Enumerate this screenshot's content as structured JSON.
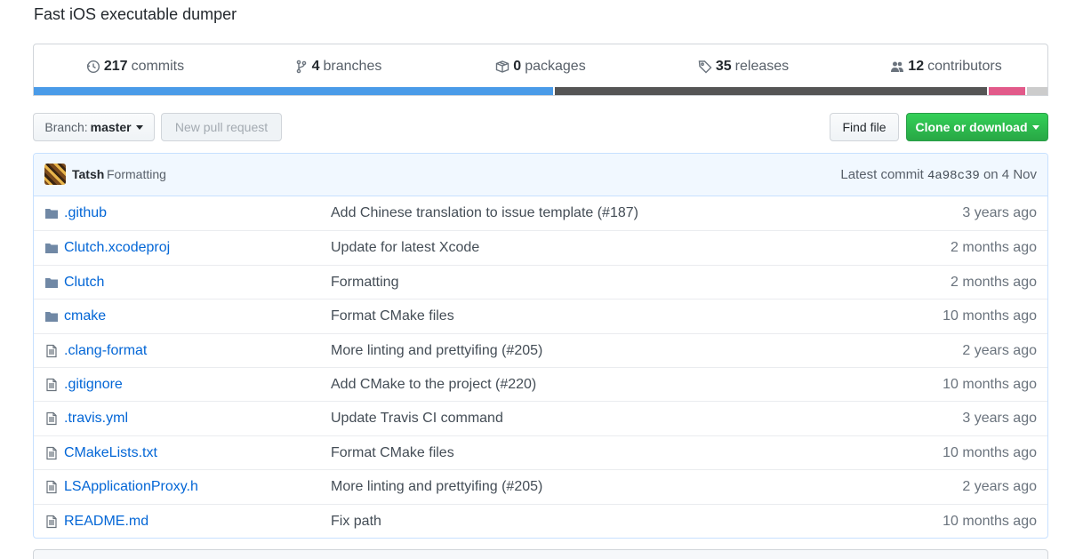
{
  "repo": {
    "description": "Fast iOS executable dumper"
  },
  "summary": {
    "commits": {
      "count": "217",
      "label": "commits",
      "icon": "history-icon"
    },
    "branches": {
      "count": "4",
      "label": "branches",
      "icon": "branch-icon"
    },
    "packages": {
      "count": "0",
      "label": "packages",
      "icon": "package-icon"
    },
    "releases": {
      "count": "35",
      "label": "releases",
      "icon": "tag-icon"
    },
    "contributors": {
      "count": "12",
      "label": "contributors",
      "icon": "people-icon"
    }
  },
  "languages": [
    {
      "color": "#4a9be8",
      "percent": 51.2
    },
    {
      "color": "#555555",
      "percent": 42.8
    },
    {
      "color": "#e25a8a",
      "percent": 3.8
    },
    {
      "color": "#cccccc",
      "percent": 2.2
    }
  ],
  "toolbar": {
    "branch_label": "Branch:",
    "branch_value": "master",
    "new_pr": "New pull request",
    "find_file": "Find file",
    "clone": "Clone or download"
  },
  "latest_commit": {
    "author": "Tatsh",
    "message": "Formatting",
    "prefix": "Latest commit",
    "sha": "4a98c39",
    "date": "on 4 Nov"
  },
  "files": [
    {
      "type": "dir",
      "name": ".github",
      "message": "Add Chinese translation to issue template (#187)",
      "age": "3 years ago"
    },
    {
      "type": "dir",
      "name": "Clutch.xcodeproj",
      "message": "Update for latest Xcode",
      "age": "2 months ago"
    },
    {
      "type": "dir",
      "name": "Clutch",
      "message": "Formatting",
      "age": "2 months ago"
    },
    {
      "type": "dir",
      "name": "cmake",
      "message": "Format CMake files",
      "age": "10 months ago"
    },
    {
      "type": "file",
      "name": ".clang-format",
      "message": "More linting and prettyifing (#205)",
      "age": "2 years ago"
    },
    {
      "type": "file",
      "name": ".gitignore",
      "message": "Add CMake to the project (#220)",
      "age": "10 months ago"
    },
    {
      "type": "file",
      "name": ".travis.yml",
      "message": "Update Travis CI command",
      "age": "3 years ago"
    },
    {
      "type": "file",
      "name": "CMakeLists.txt",
      "message": "Format CMake files",
      "age": "10 months ago"
    },
    {
      "type": "file",
      "name": "LSApplicationProxy.h",
      "message": "More linting and prettyifing (#205)",
      "age": "2 years ago"
    },
    {
      "type": "file",
      "name": "README.md",
      "message": "Fix path",
      "age": "10 months ago"
    }
  ]
}
